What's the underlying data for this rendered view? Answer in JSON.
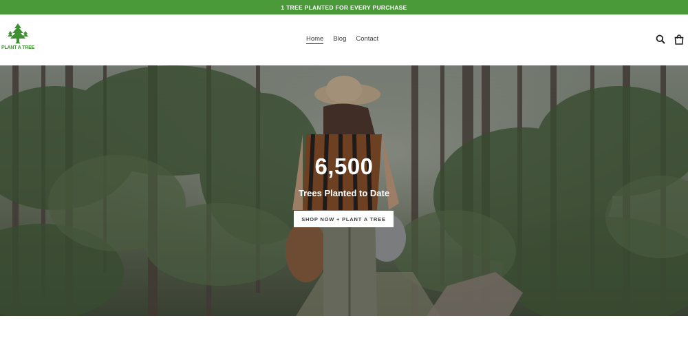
{
  "announcement": {
    "text": "1 TREE PLANTED FOR EVERY PURCHASE"
  },
  "header": {
    "logo_text": "PLANT A TREE",
    "nav": [
      {
        "label": "Home",
        "active": true
      },
      {
        "label": "Blog",
        "active": false
      },
      {
        "label": "Contact",
        "active": false
      }
    ],
    "icons": [
      "search-icon",
      "cart-icon"
    ]
  },
  "hero": {
    "number": "6,500",
    "subtitle": "Trees Planted to Date",
    "button_label": "SHOP NOW + PLANT A TREE"
  },
  "colors": {
    "accent": "#4a9a3a",
    "logo": "#3f8f33",
    "text": "#3a3a3a",
    "button_bg": "#ffffff"
  }
}
